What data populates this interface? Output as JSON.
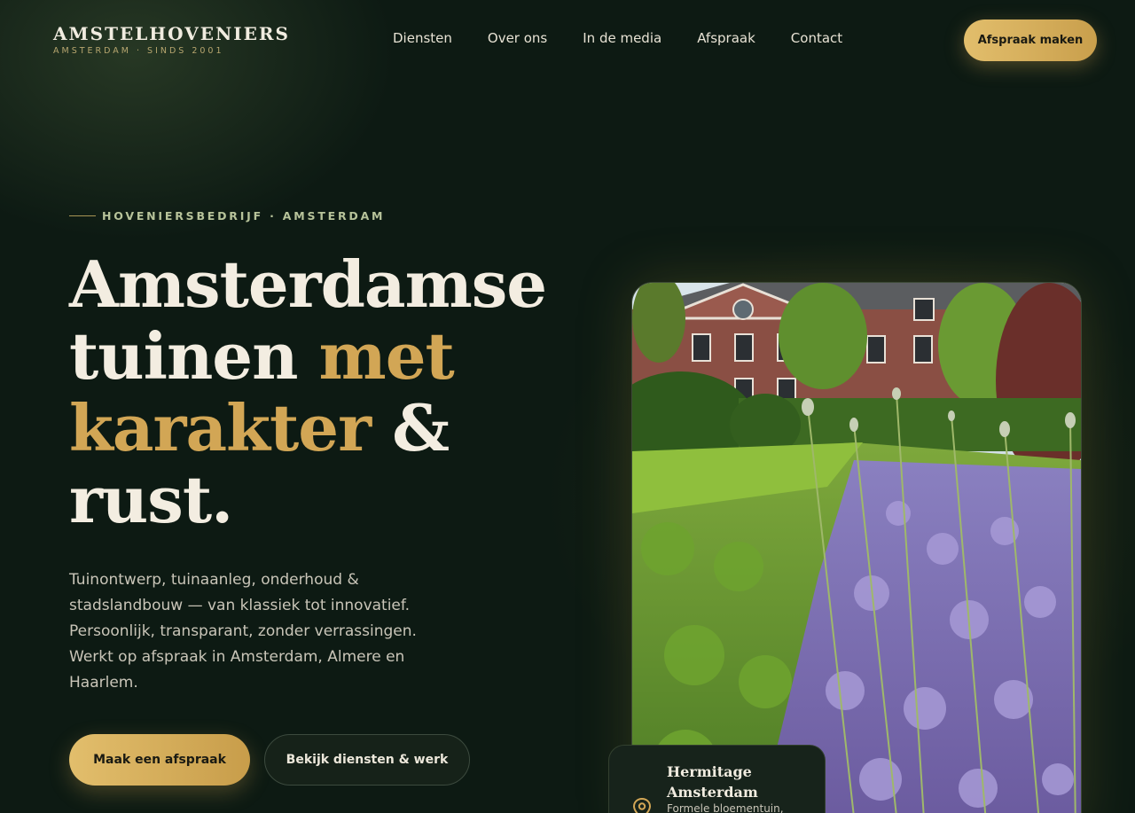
{
  "header": {
    "brand_name": "AMSTELHOVENIERS",
    "brand_sub": "AMSTERDAM · SINDS 2001",
    "nav": [
      "Diensten",
      "Over ons",
      "In de media",
      "Afspraak",
      "Contact"
    ],
    "cta": "Afspraak maken"
  },
  "hero": {
    "eyebrow": "HOVENIERSBEDRIJF · AMSTERDAM",
    "headline": {
      "l1": "Amsterdamse",
      "l2a": "tuinen ",
      "l2b": "met",
      "l3a": "karakter",
      "l3b": " &",
      "l4": "rust."
    },
    "lead": "Tuinontwerp, tuinaanleg, onderhoud & stadslandbouw — van klassiek tot innovatief. Persoonlijk, transparant, zonder verrassingen. Werkt op afspraak in Amsterdam, Almere en Haarlem.",
    "primary_button": "Maak een afspraak",
    "secondary_button": "Bekijk diensten & werk"
  },
  "feature": {
    "caption_title": "Hermitage Amsterdam",
    "caption_sub": "Formele bloementuin,"
  },
  "colors": {
    "background": "#0d1a13",
    "gold": "#d2a655",
    "cream": "#f3ede1"
  }
}
